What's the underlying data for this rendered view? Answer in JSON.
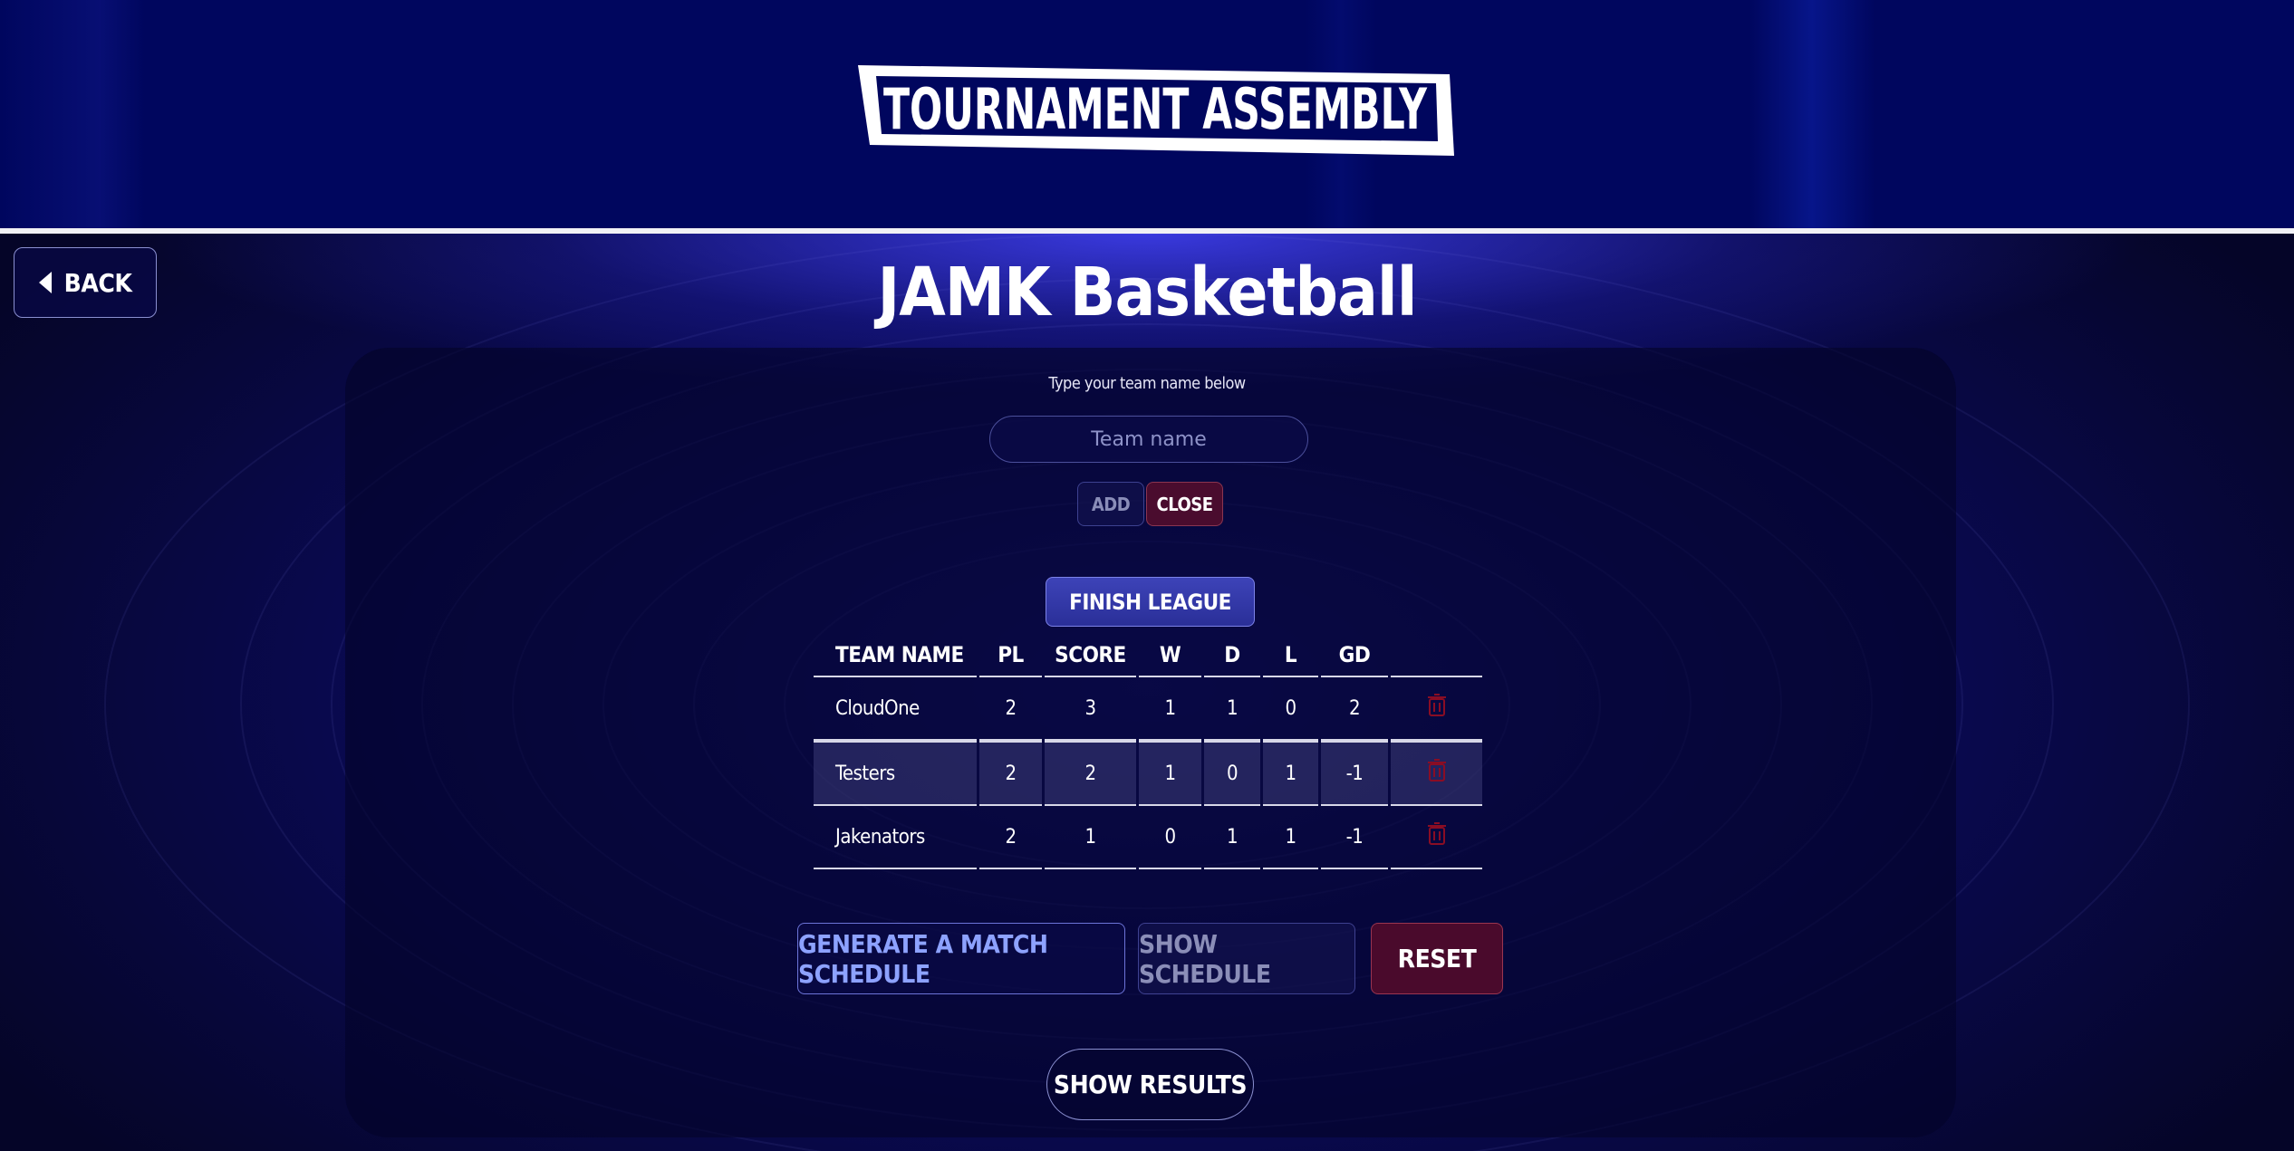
{
  "header": {
    "logo_text": "TOURNAMENT ASSEMBLY"
  },
  "nav": {
    "back_label": "BACK"
  },
  "page_title": "JAMK Basketball",
  "add_team": {
    "prompt": "Type your team name below",
    "placeholder": "Team name",
    "value": "",
    "add_label": "ADD",
    "close_label": "CLOSE"
  },
  "finish_league_label": "FINISH LEAGUE",
  "table": {
    "headers": [
      "TEAM NAME",
      "PL",
      "SCORE",
      "W",
      "D",
      "L",
      "GD"
    ],
    "rows": [
      [
        "CloudOne",
        "2",
        "3",
        "1",
        "1",
        "0",
        "2"
      ],
      [
        "Testers",
        "2",
        "2",
        "1",
        "0",
        "1",
        "-1"
      ],
      [
        "Jakenators",
        "2",
        "1",
        "0",
        "1",
        "1",
        "-1"
      ]
    ]
  },
  "actions": {
    "generate_label": "GENERATE A MATCH SCHEDULE",
    "show_schedule_label": "SHOW SCHEDULE",
    "reset_label": "RESET",
    "show_results_label": "SHOW RESULTS"
  },
  "colors": {
    "header_bg": "#00065e",
    "accent": "#2a2f98",
    "danger": "#4a0a2c",
    "trash_icon": "#8a0d24"
  }
}
